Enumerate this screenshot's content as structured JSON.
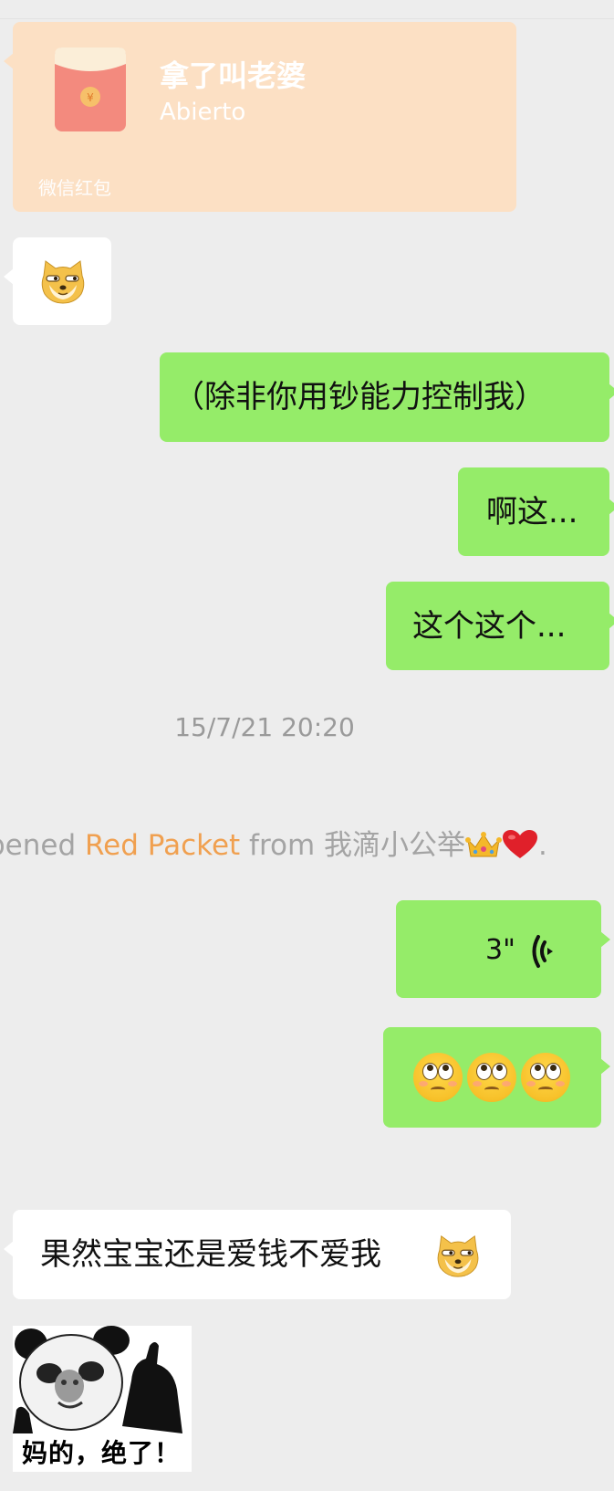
{
  "red_packet": {
    "title": "拿了叫老婆",
    "status": "Abierto",
    "footer": "微信红包",
    "color": "#fce0c4"
  },
  "messages": [
    {
      "side": "left",
      "kind": "sticker",
      "sticker": "doge-emoji"
    },
    {
      "side": "right",
      "kind": "text",
      "text": "（除非你用钞能力控制我）"
    },
    {
      "side": "right",
      "kind": "text",
      "text": "啊这..."
    },
    {
      "side": "right",
      "kind": "text",
      "text": "这个这个..."
    }
  ],
  "timestamp": "15/7/21 20:20",
  "system_message": {
    "prefix": "pened ",
    "link": "Red Packet",
    "middle": " from 我滴小公举",
    "suffix": "."
  },
  "voice_message": {
    "duration": "3\""
  },
  "emoji_message": {
    "emojis": [
      "face-with-rolling-eyes",
      "face-with-rolling-eyes",
      "face-with-rolling-eyes"
    ]
  },
  "reply": {
    "text": "果然宝宝还是爱钱不爱我"
  },
  "meme": {
    "caption": "妈的，绝了！"
  },
  "colors": {
    "background": "#ededed",
    "sent_bubble": "#95ec69",
    "received_bubble": "#ffffff",
    "link": "#f0a050",
    "system_text": "#a4a4a4"
  }
}
